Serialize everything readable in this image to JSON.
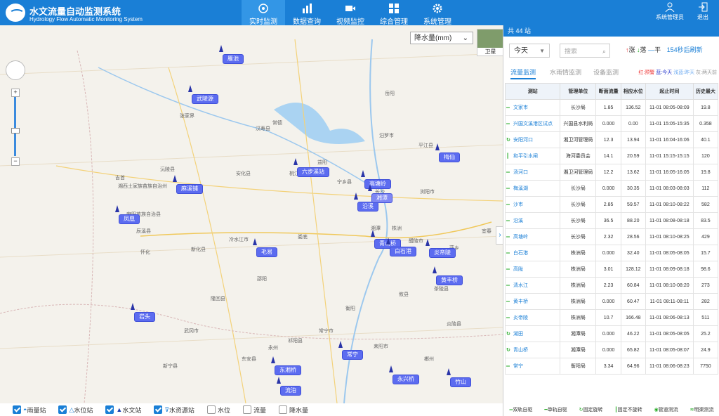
{
  "header": {
    "title": "水文流量自动监测系统",
    "subtitle": "Hydrology Flow Automatic Monitoring System",
    "nav": [
      "实时监测",
      "数据查询",
      "视频监控",
      "综合管理",
      "系统管理"
    ],
    "user": "系统管理员",
    "logout": "退出"
  },
  "map": {
    "variable_select": "降水量(mm)",
    "satellite": "卫星",
    "zoom_in": "+",
    "zoom_out": "−",
    "places": [
      "张家界",
      "常德",
      "岳阳",
      "益阳",
      "宁乡县",
      "长沙",
      "湘潭",
      "株洲",
      "娄底",
      "邵阳",
      "衡阳",
      "永州",
      "萍乡",
      "宜春",
      "怀化",
      "吉首",
      "湘西土家族苗族自治州",
      "平江县",
      "汨罗市",
      "浏阳市",
      "醴陵市",
      "攸县",
      "耒阳市",
      "郴州",
      "冷水江市",
      "新化县",
      "安化县",
      "桃江县",
      "汉寿县",
      "沅陵县",
      "辰溪县",
      "麻阳苗族自治县",
      "隆回县",
      "武冈市",
      "新宁县",
      "东安县",
      "祁阳县",
      "常宁市",
      "茶陵县",
      "炎陵县"
    ],
    "stations": [
      "雁池",
      "武陵源",
      "六步溪站",
      "高塘岭",
      "梅仙",
      "麻溪铺",
      "沿溪",
      "凤凰",
      "毛易",
      "青山桥",
      "湘潭",
      "白石港",
      "炎帝陵",
      "黄丰桥",
      "岩头",
      "常宁",
      "东湘桥",
      "永兴桥",
      "竹山",
      "流泊"
    ]
  },
  "legend": [
    {
      "label": "雨量站",
      "checked": true
    },
    {
      "label": "水位站",
      "checked": true
    },
    {
      "label": "水文站",
      "checked": true
    },
    {
      "label": "水资源站",
      "checked": true
    },
    {
      "label": "水位",
      "checked": false
    },
    {
      "label": "流量",
      "checked": false
    },
    {
      "label": "降水量",
      "checked": false
    }
  ],
  "panel": {
    "header": "共 44 站",
    "date_filter": "今天",
    "search_placeholder": "搜索",
    "trend_legend": {
      "up": "涨",
      "down": "落",
      "flat": "平"
    },
    "refresh": "154秒后刷新",
    "tabs": [
      "流量监测",
      "水雨情监测",
      "设备监测"
    ],
    "warning_legend": {
      "red": "红:预警",
      "blue": "蓝:今天",
      "lightblue": "浅蓝:昨天",
      "gray": "灰:两天前"
    },
    "columns": [
      "测站",
      "管理单位",
      "断面流量",
      "相应水位",
      "起止时间",
      "历史最大"
    ],
    "rows": [
      {
        "name": "文家市",
        "unit": "长沙局",
        "flow": "1.85",
        "level": "136.52",
        "time": "11-01 08:05-08:09",
        "max": "19.8"
      },
      {
        "name": "兴国文溪港区试点",
        "unit": "兴国县水利局",
        "flow": "0.000",
        "level": "0.00",
        "time": "11-01 15:05-15:35",
        "max": "0.358"
      },
      {
        "name": "安阳河口",
        "unit": "湘卫河管理局",
        "flow": "12.3",
        "level": "13.94",
        "time": "11-01 16:04-16:06",
        "max": "40.1"
      },
      {
        "name": "和平引水闸",
        "unit": "海河委员会",
        "flow": "14.1",
        "level": "20.59",
        "time": "11-01 15:15-15:15",
        "max": "120"
      },
      {
        "name": "汤河口",
        "unit": "湘卫河管理局",
        "flow": "12.2",
        "level": "13.62",
        "time": "11-01 16:05-16:05",
        "max": "19.8"
      },
      {
        "name": "梅溪湖",
        "unit": "长沙局",
        "flow": "0.000",
        "level": "30.35",
        "time": "11-01 08:03-08:03",
        "max": "112"
      },
      {
        "name": "沙市",
        "unit": "长沙局",
        "flow": "2.85",
        "level": "59.57",
        "time": "11-01 08:10-08:22",
        "max": "582"
      },
      {
        "name": "沿溪",
        "unit": "长沙局",
        "flow": "36.5",
        "level": "88.20",
        "time": "11-01 08:08-08:18",
        "max": "83.5"
      },
      {
        "name": "高塘岭",
        "unit": "长沙局",
        "flow": "2.32",
        "level": "28.56",
        "time": "11-01 08:10-08:25",
        "max": "429"
      },
      {
        "name": "白石港",
        "unit": "株洲局",
        "flow": "0.000",
        "level": "32.40",
        "time": "11-01 08:05-08:05",
        "max": "15.7"
      },
      {
        "name": "高陇",
        "unit": "株洲局",
        "flow": "3.01",
        "level": "128.12",
        "time": "11-01 08:09-08:18",
        "max": "98.6"
      },
      {
        "name": "清水江",
        "unit": "株洲局",
        "flow": "2.23",
        "level": "60.84",
        "time": "11-01 08:10-08:20",
        "max": "273"
      },
      {
        "name": "黄丰桥",
        "unit": "株洲局",
        "flow": "0.000",
        "level": "60.47",
        "time": "11-01 08:11-08:11",
        "max": "282"
      },
      {
        "name": "炎帝陵",
        "unit": "株洲局",
        "flow": "10.7",
        "level": "166.48",
        "time": "11-01 08:06-08:13",
        "max": "511"
      },
      {
        "name": "湖田",
        "unit": "湘潭局",
        "flow": "0.000",
        "level": "46.22",
        "time": "11-01 08:05-08:05",
        "max": "25.2"
      },
      {
        "name": "青山桥",
        "unit": "湘潭局",
        "flow": "0.000",
        "level": "65.82",
        "time": "11-01 08:05-08:07",
        "max": "24.9"
      },
      {
        "name": "常宁",
        "unit": "衡阳局",
        "flow": "3.34",
        "level": "64.96",
        "time": "11-01 08:06-08:23",
        "max": "7750"
      }
    ],
    "footer": [
      "双轨自驱",
      "单轨自驱",
      "固定旋转",
      "固定不旋转",
      "管道测流",
      "明渠测流"
    ]
  },
  "colors": {
    "primary": "#1a7fd6",
    "station": "#5c6cf0",
    "warning": "#ff6b6b"
  }
}
